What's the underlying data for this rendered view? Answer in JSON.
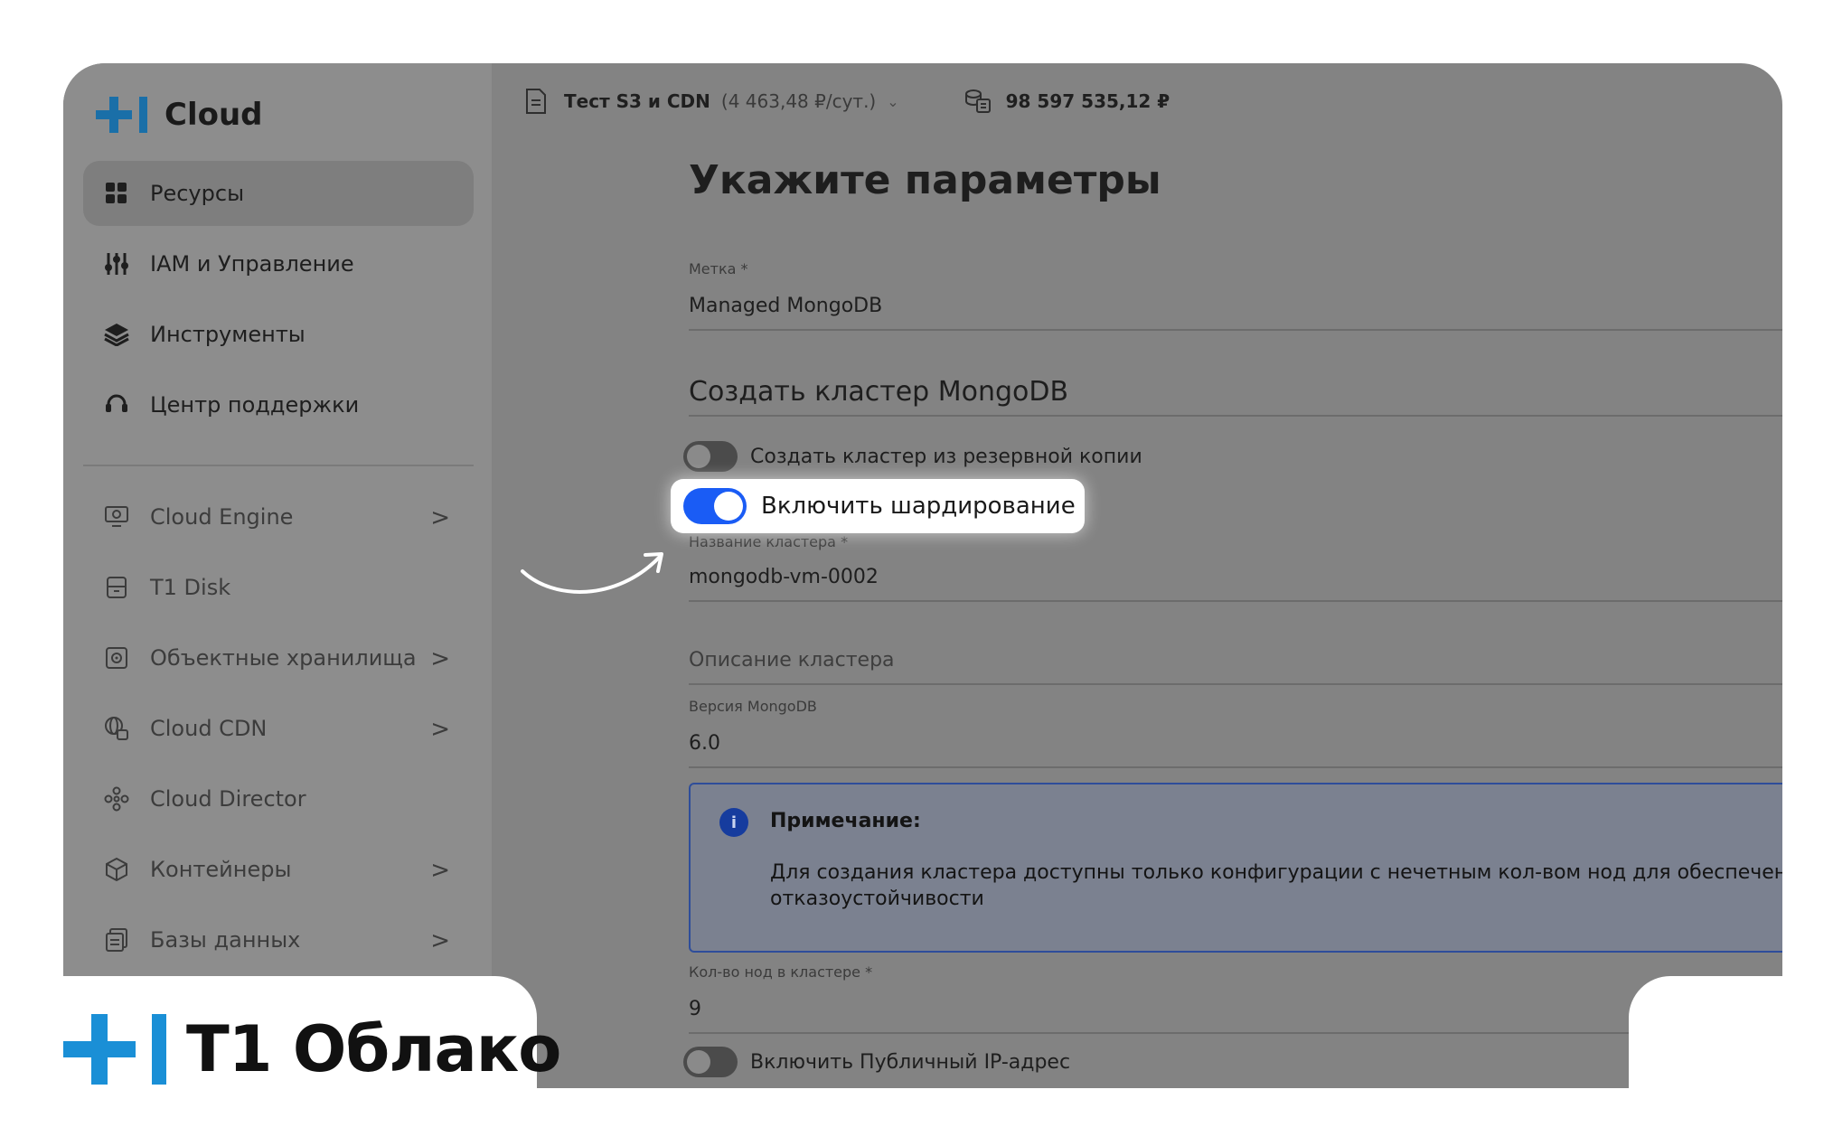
{
  "brand": {
    "name": "Cloud"
  },
  "sidebar": {
    "items": [
      {
        "label": "Ресурсы",
        "icon": "grid-icon",
        "active": true
      },
      {
        "label": "IAM и Управление",
        "icon": "sliders-icon"
      },
      {
        "label": "Инструменты",
        "icon": "layers-icon"
      },
      {
        "label": "Центр поддержки",
        "icon": "headset-icon"
      }
    ],
    "services": [
      {
        "label": "Cloud Engine",
        "icon": "monitor-icon",
        "chevron": true
      },
      {
        "label": "T1 Disk",
        "icon": "disk-icon",
        "chevron": false
      },
      {
        "label": "Объектные хранилища",
        "icon": "storage-icon",
        "chevron": true
      },
      {
        "label": "Cloud CDN",
        "icon": "globe-icon",
        "chevron": true
      },
      {
        "label": "Cloud Director",
        "icon": "nodes-icon",
        "chevron": false
      },
      {
        "label": "Контейнеры",
        "icon": "cube-icon",
        "chevron": true
      },
      {
        "label": "Базы данных",
        "icon": "database-icon",
        "chevron": true
      }
    ],
    "chevron_glyph": ">"
  },
  "topbar": {
    "project": "Тест S3 и CDN",
    "rate": "(4 463,48 ₽/сут.)",
    "dropdown_glyph": "⌄",
    "balance": "98 597 535,12 ₽"
  },
  "form": {
    "title": "Укажите параметры",
    "tag_label": "Метка *",
    "tag_value": "Managed MongoDB",
    "section_title": "Создать кластер MongoDB",
    "backup_toggle_label": "Создать кластер из резервной копии",
    "sharding_toggle_label": "Включить шардирование",
    "cluster_name_label": "Название кластера *",
    "cluster_name_value": "mongodb-vm-0002",
    "description_placeholder": "Описание кластера",
    "version_label": "Версия MongoDB",
    "version_value": "6.0",
    "note_title": "Примечание:",
    "note_text_line1": "Для создания кластера доступны только конфигурации с нечетным кол-вом нод для обеспечения",
    "note_text_line2": "отказоустойчивости",
    "node_count_label": "Кол-во нод в кластере *",
    "node_count_value": "9",
    "public_ip_toggle_label": "Включить Публичный IP-адрес"
  },
  "footer_logo": {
    "name": "T1 Облако"
  },
  "colors": {
    "accent": "#1a5cf5",
    "brand_blue": "#1a8fd6",
    "overlay": "#838383"
  }
}
